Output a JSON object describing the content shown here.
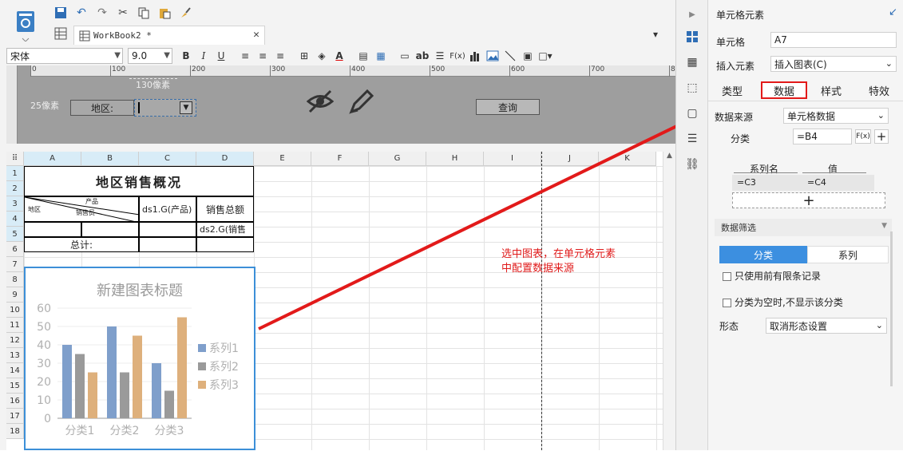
{
  "toolbar": {
    "tab_label": "WorkBook2 *",
    "font_name": "宋体",
    "font_size": "9.0",
    "bold": "B",
    "italic": "I",
    "underline": "U",
    "ab_label": "ab",
    "fx_label": "F(x)"
  },
  "ruler": {
    "ticks": [
      "0",
      "100",
      "200",
      "300",
      "400",
      "500",
      "600",
      "700",
      "800"
    ]
  },
  "form": {
    "width_hint": "130像素",
    "height_hint": "25像素",
    "region_label": "地区:",
    "query_button": "查询"
  },
  "sheet": {
    "columns": [
      "A",
      "B",
      "C",
      "D",
      "E",
      "F",
      "G",
      "H",
      "I",
      "J",
      "K"
    ],
    "rows": [
      "1",
      "2",
      "3",
      "4",
      "5",
      "6",
      "7",
      "8",
      "9",
      "10",
      "11",
      "12",
      "13",
      "14",
      "15",
      "16",
      "17",
      "18"
    ],
    "report_title": "地区销售概况",
    "diag_product": "产品",
    "diag_salesperson": "销售员",
    "diag_region": "地区",
    "cell_c3": "ds1.G(产品)",
    "cell_d3": "销售总额",
    "cell_d4": "ds2.G(销售",
    "cell_total": "总计:"
  },
  "annotation": {
    "line1": "选中图表，在单元格元素",
    "line2": "中配置数据来源"
  },
  "chart_data": {
    "type": "bar",
    "title": "新建图表标题",
    "categories": [
      "分类1",
      "分类2",
      "分类3"
    ],
    "series": [
      {
        "name": "系列1",
        "values": [
          40,
          50,
          30
        ]
      },
      {
        "name": "系列2",
        "values": [
          35,
          25,
          15
        ]
      },
      {
        "name": "系列3",
        "values": [
          25,
          45,
          55
        ]
      }
    ],
    "ylim": [
      0,
      60
    ],
    "yticks": [
      "0",
      "10",
      "20",
      "30",
      "40",
      "50",
      "60"
    ],
    "legend_position": "right",
    "colors": [
      "#7f9fcb",
      "#9a9a9a",
      "#deb07c"
    ]
  },
  "panel": {
    "title": "单元格元素",
    "cell_label": "单元格",
    "cell_value": "A7",
    "insert_label": "插入元素",
    "insert_value": "插入图表(C)",
    "tabs": [
      "类型",
      "数据",
      "样式",
      "特效"
    ],
    "active_tab": "数据",
    "datasource_label": "数据来源",
    "datasource_value": "单元格数据",
    "category_label": "分类",
    "category_value": "=B4",
    "fx": "F(x)",
    "plus": "+",
    "series_name_header": "系列名",
    "value_header": "值",
    "series_row_name": "=C3",
    "series_row_value": "=C4",
    "add_row": "+",
    "filter_title": "数据筛选",
    "filter_tab1": "分类",
    "filter_tab2": "系列",
    "option1": "只使用前有限条记录",
    "option2": "分类为空时,不显示该分类",
    "form_label": "形态",
    "form_value": "取消形态设置"
  }
}
